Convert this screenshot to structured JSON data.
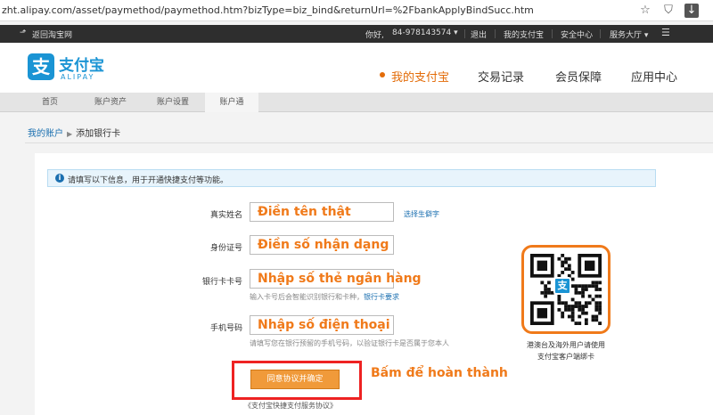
{
  "browser": {
    "url": "zht.alipay.com/asset/paymethod/paymethod.htm?bizType=biz_bind&returnUrl=%2FbankApplyBindSucc.htm"
  },
  "topnav": {
    "back": "返回淘宝网",
    "greeting": "你好,",
    "phone": "84-978143574 ▾",
    "logout": "退出",
    "my_alipay": "我的支付宝",
    "security": "安全中心",
    "service": "服务大厅 ▾"
  },
  "header": {
    "logo_glyph": "支",
    "logo_cn": "支付宝",
    "logo_en": "ALIPAY",
    "nav": [
      "我的支付宝",
      "交易记录",
      "会员保障",
      "应用中心"
    ]
  },
  "subnav": {
    "tabs": [
      "首页",
      "账户资产",
      "账户设置",
      "账户通"
    ]
  },
  "breadcrumb": {
    "parent": "我的账户",
    "current": "添加银行卡"
  },
  "notice": {
    "icon": "i",
    "text": "请填写以下信息，用于开通快捷支付等功能。"
  },
  "form": {
    "name": {
      "label": "真实姓名",
      "placeholder": "Điền tên thật",
      "side_link": "选择生僻字"
    },
    "id": {
      "label": "身份证号",
      "placeholder": "Điền số nhận dạng"
    },
    "card": {
      "label": "银行卡卡号",
      "placeholder": "Nhập số thẻ ngân hàng",
      "hint": "输入卡号后会智能识别银行和卡种，",
      "hint_link": "银行卡要求"
    },
    "mobile": {
      "label": "手机号码",
      "placeholder": "Nhập số điện thoại",
      "hint": "请填写您在银行预留的手机号码，以验证银行卡是否属于您本人"
    }
  },
  "qr": {
    "center_glyph": "支",
    "caption_1": "港澳台及海外用户请使用",
    "caption_2": "支付宝客户端绑卡"
  },
  "submit": {
    "label": "同意协议并确定",
    "annotation": "Bấm để hoàn thành"
  },
  "agreement": {
    "text": "《支付宝快捷支付服务协议》"
  },
  "colors": {
    "brand_blue": "#1a94d4",
    "accent_orange": "#f07a1a",
    "highlight_red": "#ee2222"
  }
}
